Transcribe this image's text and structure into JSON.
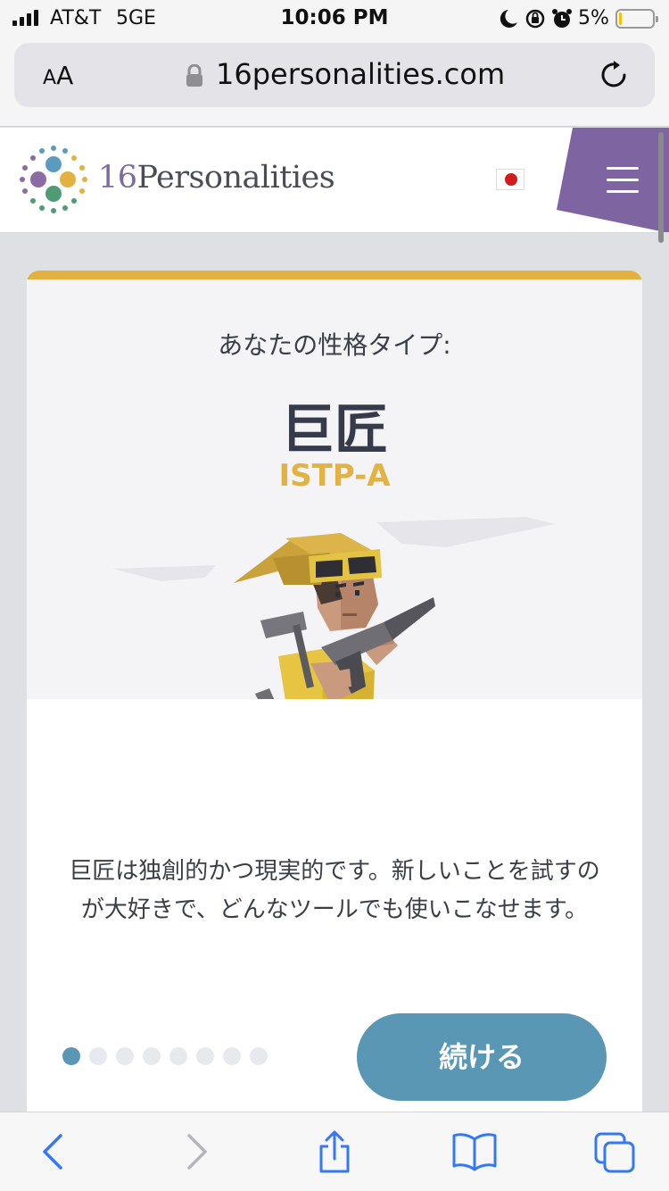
{
  "status_bar": {
    "carrier": "AT&T",
    "network": "5GE",
    "time": "10:06 PM",
    "battery_percent": "5%",
    "icons": [
      "signal-icon",
      "moon-icon",
      "rotation-lock-icon",
      "alarm-icon",
      "battery-icon"
    ]
  },
  "browser": {
    "text_size_label": "AA",
    "url": "16personalities.com",
    "icons": [
      "lock-icon",
      "reload-icon"
    ]
  },
  "header": {
    "logo_number": "16",
    "logo_name": "Personalities",
    "language_flag": "japan-flag-icon",
    "menu_icon": "hamburger-menu-icon",
    "brand_purple": "#7e64a0"
  },
  "card": {
    "subtitle": "あなたの性格タイプ:",
    "title": "巨匠",
    "code": "ISTP-A",
    "description": "巨匠は独創的かつ現実的です。新しいことを試すのが大好きで、どんなツールでも使いこなせます。",
    "continue_label": "続ける",
    "accent_color": "#e3b13f",
    "button_color": "#5a97b4",
    "pagination": {
      "total": 8,
      "current": 1
    }
  },
  "toolbar": {
    "icons": [
      "back-icon",
      "forward-icon",
      "share-icon",
      "bookmarks-icon",
      "tabs-icon"
    ]
  }
}
